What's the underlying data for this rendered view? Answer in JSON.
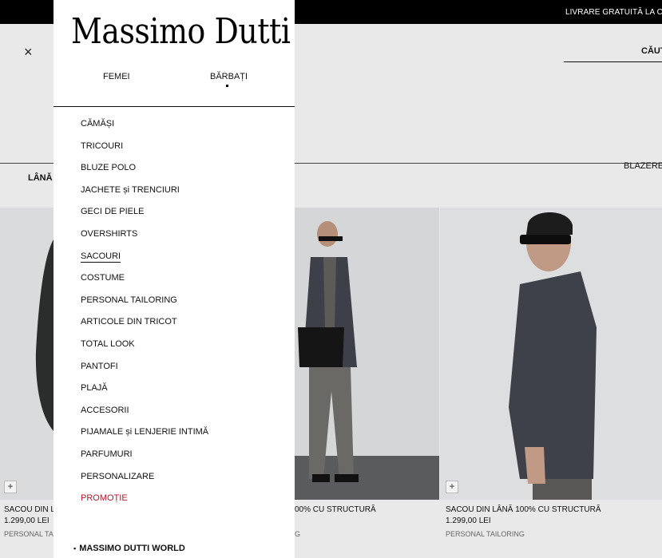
{
  "banner": {
    "text": "LIVRARE GRATUITĂ LA COM"
  },
  "header": {
    "close_icon": "close-icon",
    "search_label": "CĂUT"
  },
  "filters": {
    "active_chip": "LÂNĂ",
    "right_chip": "BLAZERE"
  },
  "menu": {
    "logo": "Massimo Dutti",
    "tabs": [
      {
        "label": "FEMEI"
      },
      {
        "label": "BĂRBAȚI"
      }
    ],
    "items": [
      {
        "label": "CĂMĂȘI"
      },
      {
        "label": "TRICOURI"
      },
      {
        "label": "BLUZE POLO"
      },
      {
        "label": "JACHETE și TRENCIURI"
      },
      {
        "label": "GECI DE PIELE"
      },
      {
        "label": "OVERSHIRTS"
      },
      {
        "label": "SACOURI"
      },
      {
        "label": "COSTUME"
      },
      {
        "label": "PERSONAL TAILORING"
      },
      {
        "label": "ARTICOLE DIN TRICOT"
      },
      {
        "label": "TOTAL LOOK"
      },
      {
        "label": "PANTOFI"
      },
      {
        "label": "PLAJĂ"
      },
      {
        "label": "ACCESORII"
      },
      {
        "label": "PIJAMALE și LENJERIE INTIMĂ"
      },
      {
        "label": "PARFUMURI"
      },
      {
        "label": "PERSONALIZARE"
      },
      {
        "label": "PROMOȚIE"
      }
    ],
    "world": "MASSIMO DUTTI WORLD",
    "promo_color": "#b21b2b"
  },
  "products": [
    {
      "name": "SACOU DIN LÂ",
      "price": "1.299,00 LEI",
      "collection": "PERSONAL TAILO"
    },
    {
      "name": "00% CU STRUCTURĂ",
      "price": "",
      "collection": "G"
    },
    {
      "name": "SACOU DIN LÂNĂ 100% CU STRUCTURĂ",
      "price": "1.299,00 LEI",
      "collection": "PERSONAL TAILORING"
    }
  ],
  "icons": {
    "plus": "+",
    "close": "×"
  }
}
